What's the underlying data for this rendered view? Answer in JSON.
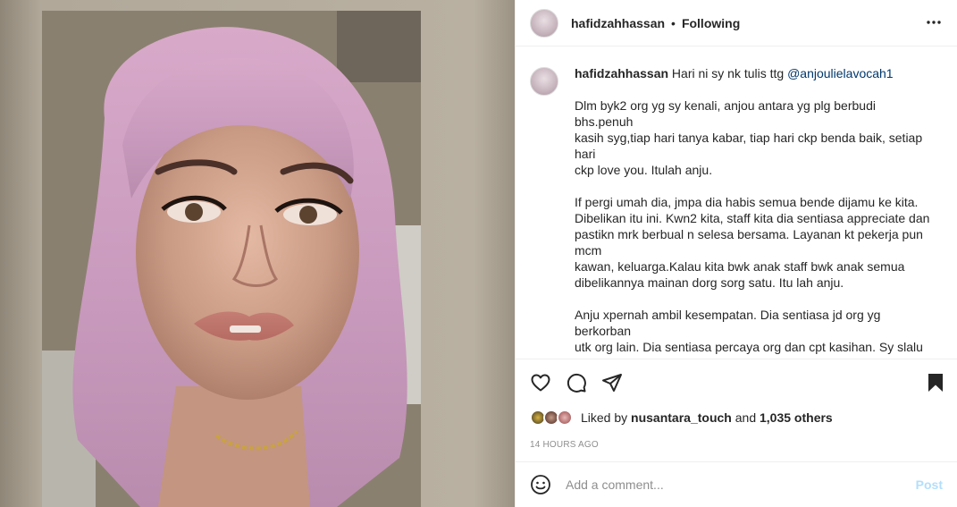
{
  "header": {
    "username": "hafidzahhassan",
    "separator": "•",
    "follow_status": "Following",
    "more_icon": "more-horizontal-icon"
  },
  "caption": {
    "username": "hafidzahhassan",
    "intro": "Hari ni sy nk tulis ttg",
    "mention": "@anjoulielavocah1",
    "paragraphs": [
      "Dlm byk2 org yg sy kenali, anjou antara yg plg berbudi bhs.penuh\nkasih syg,tiap hari tanya kabar, tiap hari ckp benda baik, setiap hari\nckp love you. Itulah anju.",
      "If pergi umah dia, jmpa dia habis semua bende dijamu ke kita.\nDibelikan itu ini. Kwn2 kita, staff kita dia sentiasa appreciate dan\npastikn mrk berbual n selesa bersama. Layanan kt pekerja pun mcm\nkawan, keluarga.Kalau kita bwk anak staff bwk anak semua\ndibelikannya mainan dorg sorg satu. Itu lah anju.",
      "Anju xpernah ambil kesempatan. Dia sentiasa jd org yg berkorban\nutk org lain. Dia sentiasa percaya org dan cpt kasihan. Sy slalu rasa\nsedih sbb anju akan berakhir dgn kecewa bila ramai org yg ambil\nkesempatan dlm kebaikannya. Dia ingat semua org ikhlas dan baik\nmcm dia."
    ]
  },
  "actions": {
    "like_icon": "heart-icon",
    "comment_icon": "comment-icon",
    "share_icon": "share-icon",
    "save_icon": "bookmark-icon"
  },
  "likes": {
    "prefix": "Liked by",
    "user": "nusantara_touch",
    "conjunction": "and",
    "others": "1,035 others"
  },
  "timestamp": "14 HOURS AGO",
  "comment": {
    "emoji_icon": "smiley-icon",
    "placeholder": "Add a comment...",
    "post_label": "Post"
  },
  "colors": {
    "link": "#00376b",
    "post_disabled": "#b2dffc",
    "muted": "#8e8e8e"
  }
}
